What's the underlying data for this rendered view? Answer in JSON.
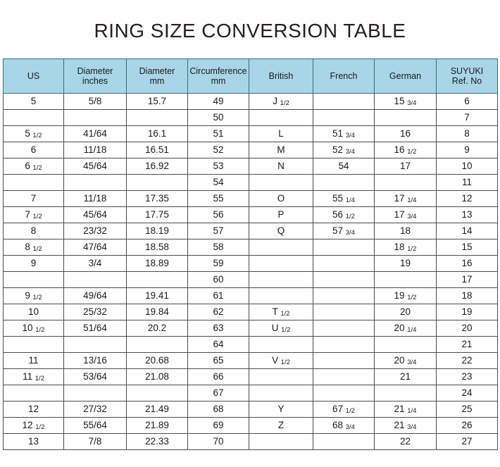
{
  "title": "RING SIZE CONVERSION TABLE",
  "colors": {
    "header_background": "#a8d5e8",
    "border": "#4d4d4d",
    "header_border": "#3c6b7d",
    "text": "#1a1a1a",
    "page_background": "#ffffff"
  },
  "table": {
    "columns": [
      {
        "key": "us",
        "lines": [
          "US",
          ""
        ]
      },
      {
        "key": "diameter_in",
        "lines": [
          "Diameter",
          "inches"
        ]
      },
      {
        "key": "diameter_mm",
        "lines": [
          "Diameter",
          "mm"
        ]
      },
      {
        "key": "circumference",
        "lines": [
          "Circumference",
          "mm"
        ]
      },
      {
        "key": "british",
        "lines": [
          "British",
          ""
        ]
      },
      {
        "key": "french",
        "lines": [
          "French",
          ""
        ]
      },
      {
        "key": "german",
        "lines": [
          "German",
          ""
        ]
      },
      {
        "key": "suyuki",
        "lines": [
          "SUYUKI",
          "Ref. No"
        ]
      }
    ],
    "rows": [
      {
        "us": "5",
        "us_frac": "",
        "diameter_in": "5/8",
        "diameter_mm": "15.7",
        "circumference": "49",
        "british": "J",
        "british_frac": "1/2",
        "french": "",
        "french_frac": "",
        "german": "15",
        "german_frac": "3/4",
        "suyuki": "6"
      },
      {
        "us": "",
        "us_frac": "",
        "diameter_in": "",
        "diameter_mm": "",
        "circumference": "50",
        "british": "",
        "british_frac": "",
        "french": "",
        "french_frac": "",
        "german": "",
        "german_frac": "",
        "suyuki": "7"
      },
      {
        "us": "5",
        "us_frac": "1/2",
        "diameter_in": "41/64",
        "diameter_mm": "16.1",
        "circumference": "51",
        "british": "L",
        "british_frac": "",
        "french": "51",
        "french_frac": "3/4",
        "german": "16",
        "german_frac": "",
        "suyuki": "8"
      },
      {
        "us": "6",
        "us_frac": "",
        "diameter_in": "11/18",
        "diameter_mm": "16.51",
        "circumference": "52",
        "british": "M",
        "british_frac": "",
        "french": "52",
        "french_frac": "3/4",
        "german": "16",
        "german_frac": "1/2",
        "suyuki": "9"
      },
      {
        "us": "6",
        "us_frac": "1/2",
        "diameter_in": "45/64",
        "diameter_mm": "16.92",
        "circumference": "53",
        "british": "N",
        "british_frac": "",
        "french": "54",
        "french_frac": "",
        "german": "17",
        "german_frac": "",
        "suyuki": "10"
      },
      {
        "us": "",
        "us_frac": "",
        "diameter_in": "",
        "diameter_mm": "",
        "circumference": "54",
        "british": "",
        "british_frac": "",
        "french": "",
        "french_frac": "",
        "german": "",
        "german_frac": "",
        "suyuki": "11"
      },
      {
        "us": "7",
        "us_frac": "",
        "diameter_in": "11/18",
        "diameter_mm": "17.35",
        "circumference": "55",
        "british": "O",
        "british_frac": "",
        "french": "55",
        "french_frac": "1/4",
        "german": "17",
        "german_frac": "1/4",
        "suyuki": "12"
      },
      {
        "us": "7",
        "us_frac": "1/2",
        "diameter_in": "45/64",
        "diameter_mm": "17.75",
        "circumference": "56",
        "british": "P",
        "british_frac": "",
        "french": "56",
        "french_frac": "1/2",
        "german": "17",
        "german_frac": "3/4",
        "suyuki": "13"
      },
      {
        "us": "8",
        "us_frac": "",
        "diameter_in": "23/32",
        "diameter_mm": "18.19",
        "circumference": "57",
        "british": "Q",
        "british_frac": "",
        "french": "57",
        "french_frac": "3/4",
        "german": "18",
        "german_frac": "",
        "suyuki": "14"
      },
      {
        "us": "8",
        "us_frac": "1/2",
        "diameter_in": "47/64",
        "diameter_mm": "18.58",
        "circumference": "58",
        "british": "",
        "british_frac": "",
        "french": "",
        "french_frac": "",
        "german": "18",
        "german_frac": "1/2",
        "suyuki": "15"
      },
      {
        "us": "9",
        "us_frac": "",
        "diameter_in": "3/4",
        "diameter_mm": "18.89",
        "circumference": "59",
        "british": "",
        "british_frac": "",
        "french": "",
        "french_frac": "",
        "german": "19",
        "german_frac": "",
        "suyuki": "16"
      },
      {
        "us": "",
        "us_frac": "",
        "diameter_in": "",
        "diameter_mm": "",
        "circumference": "60",
        "british": "",
        "british_frac": "",
        "french": "",
        "french_frac": "",
        "german": "",
        "german_frac": "",
        "suyuki": "17"
      },
      {
        "us": "9",
        "us_frac": "1/2",
        "diameter_in": "49/64",
        "diameter_mm": "19.41",
        "circumference": "61",
        "british": "",
        "british_frac": "",
        "french": "",
        "french_frac": "",
        "german": "19",
        "german_frac": "1/2",
        "suyuki": "18"
      },
      {
        "us": "10",
        "us_frac": "",
        "diameter_in": "25/32",
        "diameter_mm": "19.84",
        "circumference": "62",
        "british": "T",
        "british_frac": "1/2",
        "french": "",
        "french_frac": "",
        "german": "20",
        "german_frac": "",
        "suyuki": "19"
      },
      {
        "us": "10",
        "us_frac": "1/2",
        "diameter_in": "51/64",
        "diameter_mm": "20.2",
        "circumference": "63",
        "british": "U",
        "british_frac": "1/2",
        "french": "",
        "french_frac": "",
        "german": "20",
        "german_frac": "1/4",
        "suyuki": "20"
      },
      {
        "us": "",
        "us_frac": "",
        "diameter_in": "",
        "diameter_mm": "",
        "circumference": "64",
        "british": "",
        "british_frac": "",
        "french": "",
        "french_frac": "",
        "german": "",
        "german_frac": "",
        "suyuki": "21"
      },
      {
        "us": "11",
        "us_frac": "",
        "diameter_in": "13/16",
        "diameter_mm": "20.68",
        "circumference": "65",
        "british": "V",
        "british_frac": "1/2",
        "french": "",
        "french_frac": "",
        "german": "20",
        "german_frac": "3/4",
        "suyuki": "22"
      },
      {
        "us": "11",
        "us_frac": "1/2",
        "diameter_in": "53/64",
        "diameter_mm": "21.08",
        "circumference": "66",
        "british": "",
        "british_frac": "",
        "french": "",
        "french_frac": "",
        "german": "21",
        "german_frac": "",
        "suyuki": "23"
      },
      {
        "us": "",
        "us_frac": "",
        "diameter_in": "",
        "diameter_mm": "",
        "circumference": "67",
        "british": "",
        "british_frac": "",
        "french": "",
        "french_frac": "",
        "german": "",
        "german_frac": "",
        "suyuki": "24"
      },
      {
        "us": "12",
        "us_frac": "",
        "diameter_in": "27/32",
        "diameter_mm": "21.49",
        "circumference": "68",
        "british": "Y",
        "british_frac": "",
        "french": "67",
        "french_frac": "1/2",
        "german": "21",
        "german_frac": "1/4",
        "suyuki": "25"
      },
      {
        "us": "12",
        "us_frac": "1/2",
        "diameter_in": "55/64",
        "diameter_mm": "21.89",
        "circumference": "69",
        "british": "Z",
        "british_frac": "",
        "french": "68",
        "french_frac": "3/4",
        "german": "21",
        "german_frac": "3/4",
        "suyuki": "26"
      },
      {
        "us": "13",
        "us_frac": "",
        "diameter_in": "7/8",
        "diameter_mm": "22.33",
        "circumference": "70",
        "british": "",
        "british_frac": "",
        "french": "",
        "french_frac": "",
        "german": "22",
        "german_frac": "",
        "suyuki": "27"
      }
    ]
  }
}
